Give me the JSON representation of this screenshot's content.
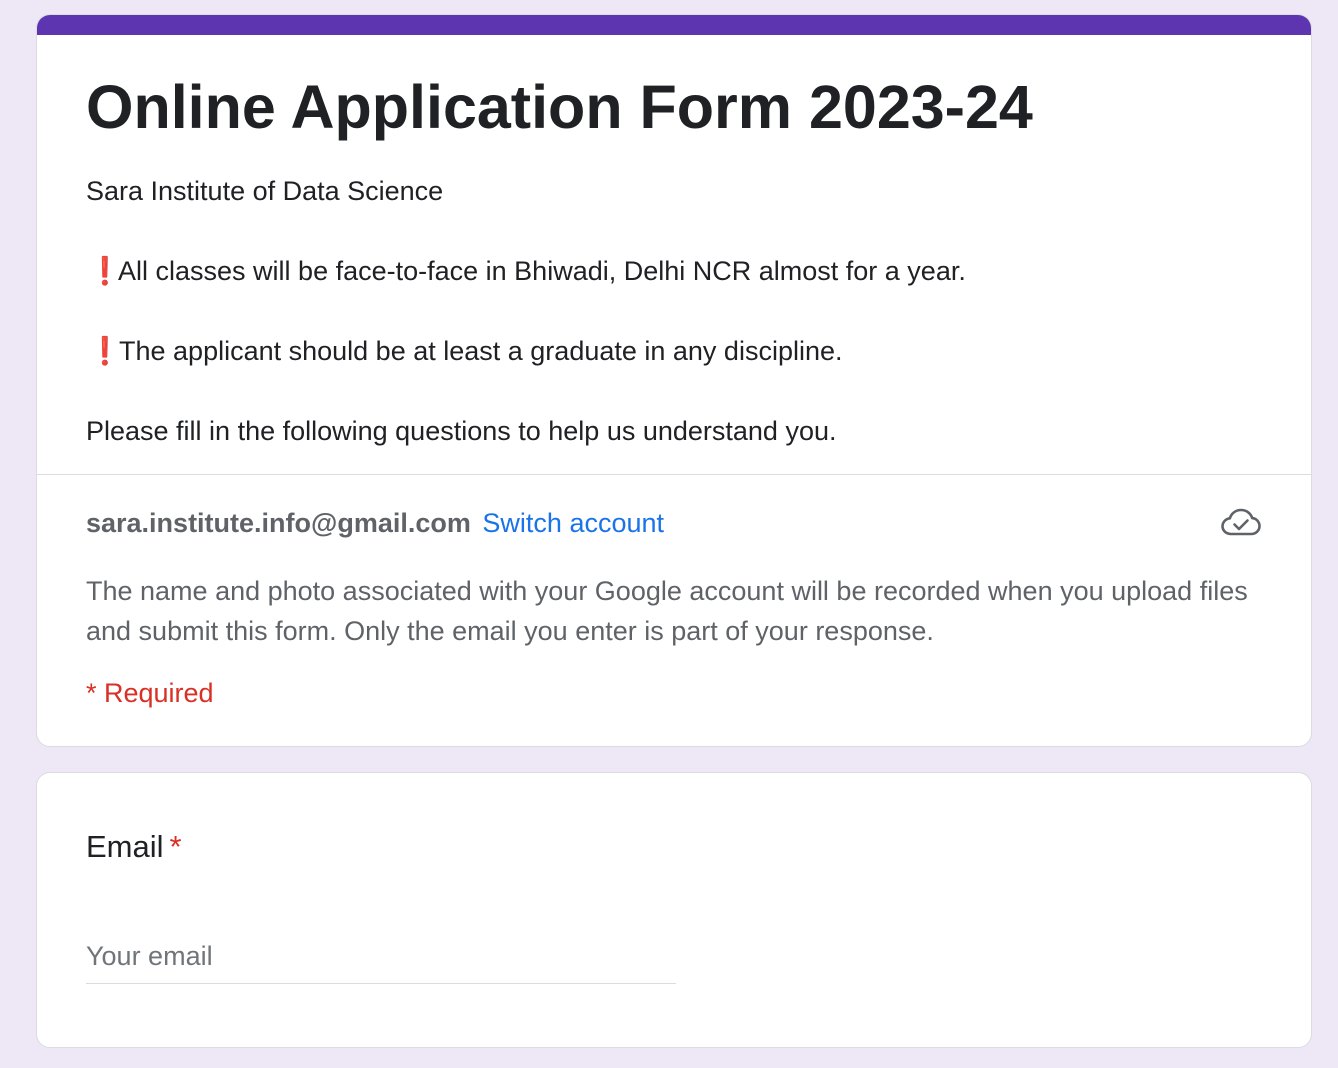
{
  "header": {
    "title": "Online Application Form 2023-24",
    "organization": "Sara Institute of Data Science",
    "notice_1": "All classes will be face-to-face in Bhiwadi, Delhi NCR almost for a year.",
    "notice_2": "The applicant should be at least a graduate in any discipline.",
    "notice_icon": "❗",
    "instructions": "Please fill in the following questions to help us understand you."
  },
  "account": {
    "email": "sara.institute.info@gmail.com",
    "switch_label": "Switch account",
    "cloud_icon": "cloud-done-icon",
    "privacy_note": "The name and photo associated with your Google account will be recorded when you upload files and submit this form. Only the email you enter is part of your response.",
    "required_note": "* Required"
  },
  "questions": [
    {
      "label": "Email",
      "required_marker": "*",
      "placeholder": "Your email",
      "value": ""
    }
  ],
  "colors": {
    "accent": "#5e35b1",
    "background": "#ede7f6",
    "link": "#1a73e8",
    "required": "#d93025",
    "warning": "#e0201b"
  }
}
